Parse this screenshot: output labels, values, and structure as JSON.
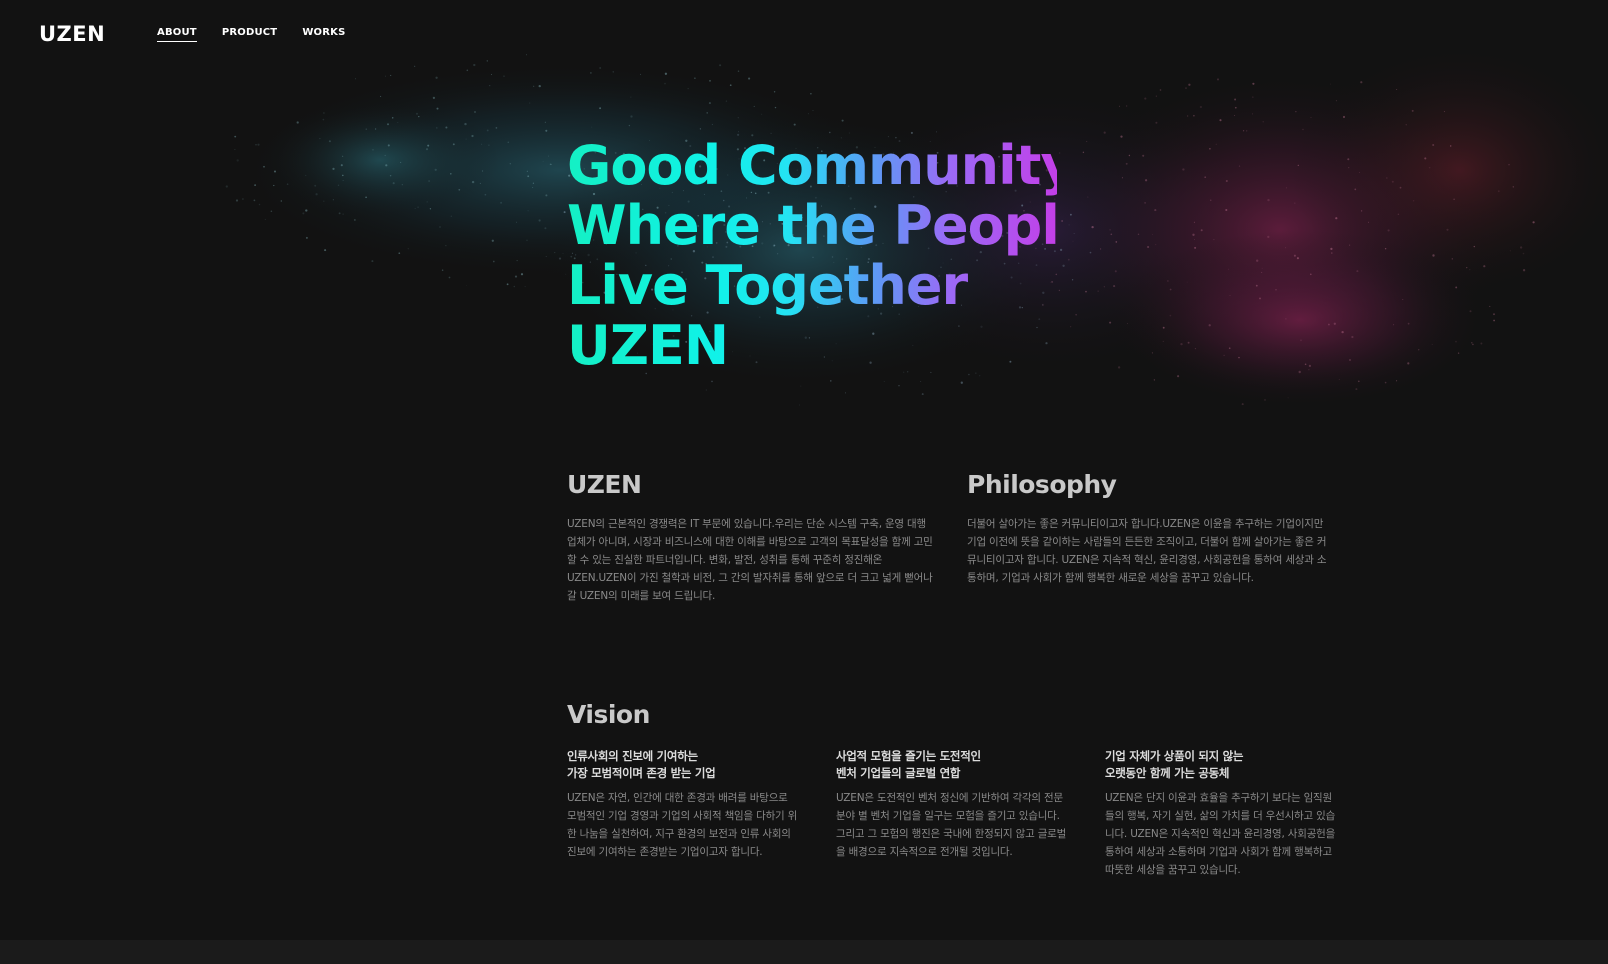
{
  "nav": {
    "logo": "UZEN",
    "items": [
      {
        "label": "ABOUT",
        "active": true
      },
      {
        "label": "PRODUCT",
        "active": false
      },
      {
        "label": "WORKS",
        "active": false
      }
    ]
  },
  "hero": {
    "lines": [
      "Good Community",
      "Where the People",
      "Live Together",
      "UZEN"
    ]
  },
  "about": {
    "title": "UZEN",
    "body": "UZEN의 근본적인 경쟁력은 IT 부문에 있습니다.우리는 단순 시스템 구축, 운영 대행업체가 아니며, 시장과 비즈니스에 대한 이해를 바탕으로 고객의 목표달성을 함께 고민할 수 있는 진실한 파트너입니다. 변화, 발전, 성취를 통해 꾸준히 정진해온 UZEN.UZEN이 가진 철학과 비전, 그 간의 발자취를 통해 앞으로 더 크고 넓게 뻗어나갈 UZEN의 미래를 보여 드립니다."
  },
  "philosophy": {
    "title": "Philosophy",
    "body": "더불어 살아가는 좋은 커뮤니티이고자 합니다.UZEN은 이윤을 추구하는 기업이지만 기업 이전에 뜻을 같이하는 사람들의 든든한 조직이고, 더불어 함께 살아가는 좋은 커뮤니티이고자 합니다. UZEN은 지속적 혁신, 윤리경영, 사회공헌을 통하여 세상과 소통하며, 기업과 사회가 함께 행복한 새로운 세상을 꿈꾸고 있습니다."
  },
  "vision": {
    "title": "Vision",
    "items": [
      {
        "heading": [
          "인류사회의 진보에 기여하는",
          "가장 모범적이며 존경 받는 기업"
        ],
        "body": "UZEN은 자연, 인간에 대한 존경과 배려를 바탕으로 모범적인 기업 경영과 기업의 사회적 책임을 다하기 위한 나눔을 실천하여, 지구 환경의 보전과 인류 사회의 진보에 기여하는 존경받는 기업이고자 합니다."
      },
      {
        "heading": [
          "사업적 모험을 즐기는 도전적인",
          "벤처 기업들의 글로벌 연합"
        ],
        "body": "UZEN은 도전적인 벤처 정신에 기반하여 각각의 전문 분야 별 벤처 기업을 일구는 모험을 즐기고 있습니다. 그리고 그 모험의 행진은 국내에 한정되지 않고 글로벌을 배경으로 지속적으로 전개될 것입니다."
      },
      {
        "heading": [
          "기업 자체가 상품이 되지 않는",
          "오랫동안 함께 가는 공동체"
        ],
        "body": "UZEN은 단지 이윤과 효율을 추구하기 보다는 임직원들의 행복, 자기 실현, 삶의 가치를 더 우선시하고 있습 니다. UZEN은 지속적인 혁신과 윤리경영, 사회공헌을 통하여 세상과 소통하며 기업과 사회가 함께 행복하고 따뜻한 세상을 꿈꾸고 있습니다."
      }
    ]
  },
  "colors": {
    "background": "#121212",
    "gradient_start": "#14f0c4",
    "gradient_mid": "#10f2e8",
    "gradient_end": "#c33fe8",
    "nebula_teal": "#1e5a6a",
    "nebula_magenta": "#7a1f4f"
  }
}
